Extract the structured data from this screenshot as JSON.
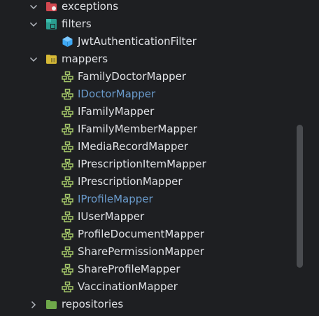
{
  "tree": {
    "rows": [
      {
        "label": "exceptions",
        "icon": "package-folder-icon-red",
        "expanded": true,
        "level": 1
      },
      {
        "label": "filters",
        "icon": "package-folder-icon-teal",
        "expanded": true,
        "level": 1
      },
      {
        "label": "JwtAuthenticationFilter",
        "icon": "class-cube-icon",
        "level": 2
      },
      {
        "label": "mappers",
        "icon": "package-folder-icon-yellow",
        "expanded": true,
        "level": 1
      },
      {
        "label": "FamilyDoctorMapper",
        "icon": "mapper-icon",
        "level": 2
      },
      {
        "label": "IDoctorMapper",
        "icon": "mapper-icon",
        "level": 2,
        "color": "#6a9bcc"
      },
      {
        "label": "IFamilyMapper",
        "icon": "mapper-icon",
        "level": 2
      },
      {
        "label": "IFamilyMemberMapper",
        "icon": "mapper-icon",
        "level": 2
      },
      {
        "label": "IMediaRecordMapper",
        "icon": "mapper-icon",
        "level": 2
      },
      {
        "label": "IPrescriptionItemMapper",
        "icon": "mapper-icon",
        "level": 2
      },
      {
        "label": "IPrescriptionMapper",
        "icon": "mapper-icon",
        "level": 2
      },
      {
        "label": "IProfileMapper",
        "icon": "mapper-icon",
        "level": 2,
        "color": "#6a9bcc"
      },
      {
        "label": "IUserMapper",
        "icon": "mapper-icon",
        "level": 2
      },
      {
        "label": "ProfileDocumentMapper",
        "icon": "mapper-icon",
        "level": 2
      },
      {
        "label": "SharePermissionMapper",
        "icon": "mapper-icon",
        "level": 2
      },
      {
        "label": "ShareProfileMapper",
        "icon": "mapper-icon",
        "level": 2
      },
      {
        "label": "VaccinationMapper",
        "icon": "mapper-icon",
        "level": 2
      },
      {
        "label": "repositories",
        "icon": "package-folder-icon-green",
        "expanded": false,
        "level": 1
      }
    ]
  },
  "colors": {
    "background": "#1e1f22",
    "text": "#dfe1e5",
    "vcs_modified": "#6a9bcc",
    "mapper_icon": "#a4c769",
    "class_icon": "#3fa9f5"
  }
}
